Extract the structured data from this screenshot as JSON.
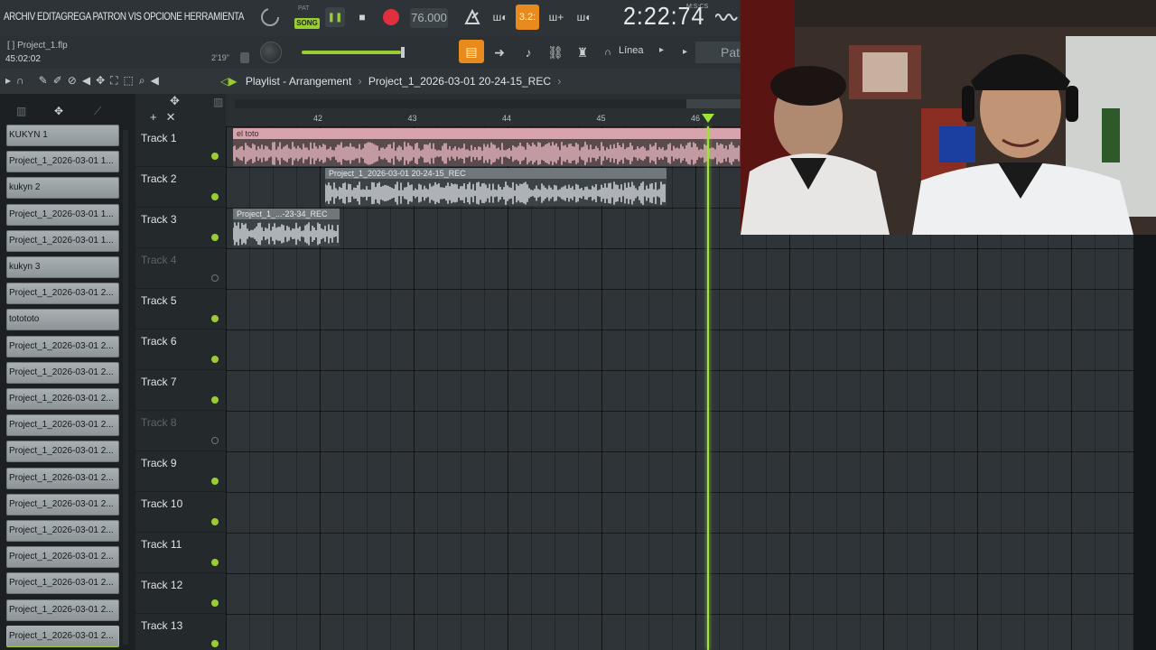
{
  "menu": {
    "items_text": "ARCHIV EDITAGREGA PATRON VIS OPCIONE HERRAMIENTA"
  },
  "transport": {
    "pat_label": "PAT",
    "song_label": "SONG",
    "play_icon": "pause-icon",
    "tempo": "76.000",
    "blend_label": "3.2:",
    "time": "2:22:74",
    "time_sub": "M:S:CS"
  },
  "project": {
    "file_name": "Project_1.flp",
    "bracket": "[ ]",
    "time": "45:02:02",
    "hint_time": "2'19\""
  },
  "snap": {
    "label": "Línea",
    "pattern_label": "Patr"
  },
  "playlist": {
    "title": "Playlist - Arrangement",
    "separator": "›",
    "pattern": "Project_1_2026-03-01 20-24-15_REC",
    "ruler_ticks": [
      "42",
      "43",
      "44",
      "45",
      "46"
    ]
  },
  "browser": {
    "items": [
      "KUKYN 1",
      "Project_1_2026-03-01 1...",
      "kukyn 2",
      "Project_1_2026-03-01 1...",
      "Project_1_2026-03-01 1...",
      "kukyn 3",
      "Project_1_2026-03-01 2...",
      "totototo",
      "Project_1_2026-03-01 2...",
      "Project_1_2026-03-01 2...",
      "Project_1_2026-03-01 2...",
      "Project_1_2026-03-01 2...",
      "Project_1_2026-03-01 2...",
      "Project_1_2026-03-01 2...",
      "Project_1_2026-03-01 2...",
      "Project_1_2026-03-01 2...",
      "Project_1_2026-03-01 2...",
      "Project_1_2026-03-01 2...",
      "Project_1_2026-03-01 2...",
      "Project_1_2026-03-01 2..."
    ]
  },
  "tracks": [
    {
      "name": "Track 1",
      "active": true
    },
    {
      "name": "Track 2",
      "active": true
    },
    {
      "name": "Track 3",
      "active": true
    },
    {
      "name": "Track 4",
      "active": false
    },
    {
      "name": "Track 5",
      "active": true
    },
    {
      "name": "Track 6",
      "active": true
    },
    {
      "name": "Track 7",
      "active": true
    },
    {
      "name": "Track 8",
      "active": false
    },
    {
      "name": "Track 9",
      "active": true
    },
    {
      "name": "Track 10",
      "active": true
    },
    {
      "name": "Track 11",
      "active": true
    },
    {
      "name": "Track 12",
      "active": true
    },
    {
      "name": "Track 13",
      "active": true
    }
  ],
  "clips": [
    {
      "label": "el toto"
    },
    {
      "label": "Project_1_2026-03-01 20-24-15_REC"
    },
    {
      "label": "Project_1_...-23-34_REC"
    }
  ],
  "colors": {
    "accent_green": "#9acd32",
    "accent_orange": "#e98a1c",
    "record_red": "#e0303d",
    "clip_pink": "#d9a3ad",
    "clip_grey": "#8e969a"
  }
}
